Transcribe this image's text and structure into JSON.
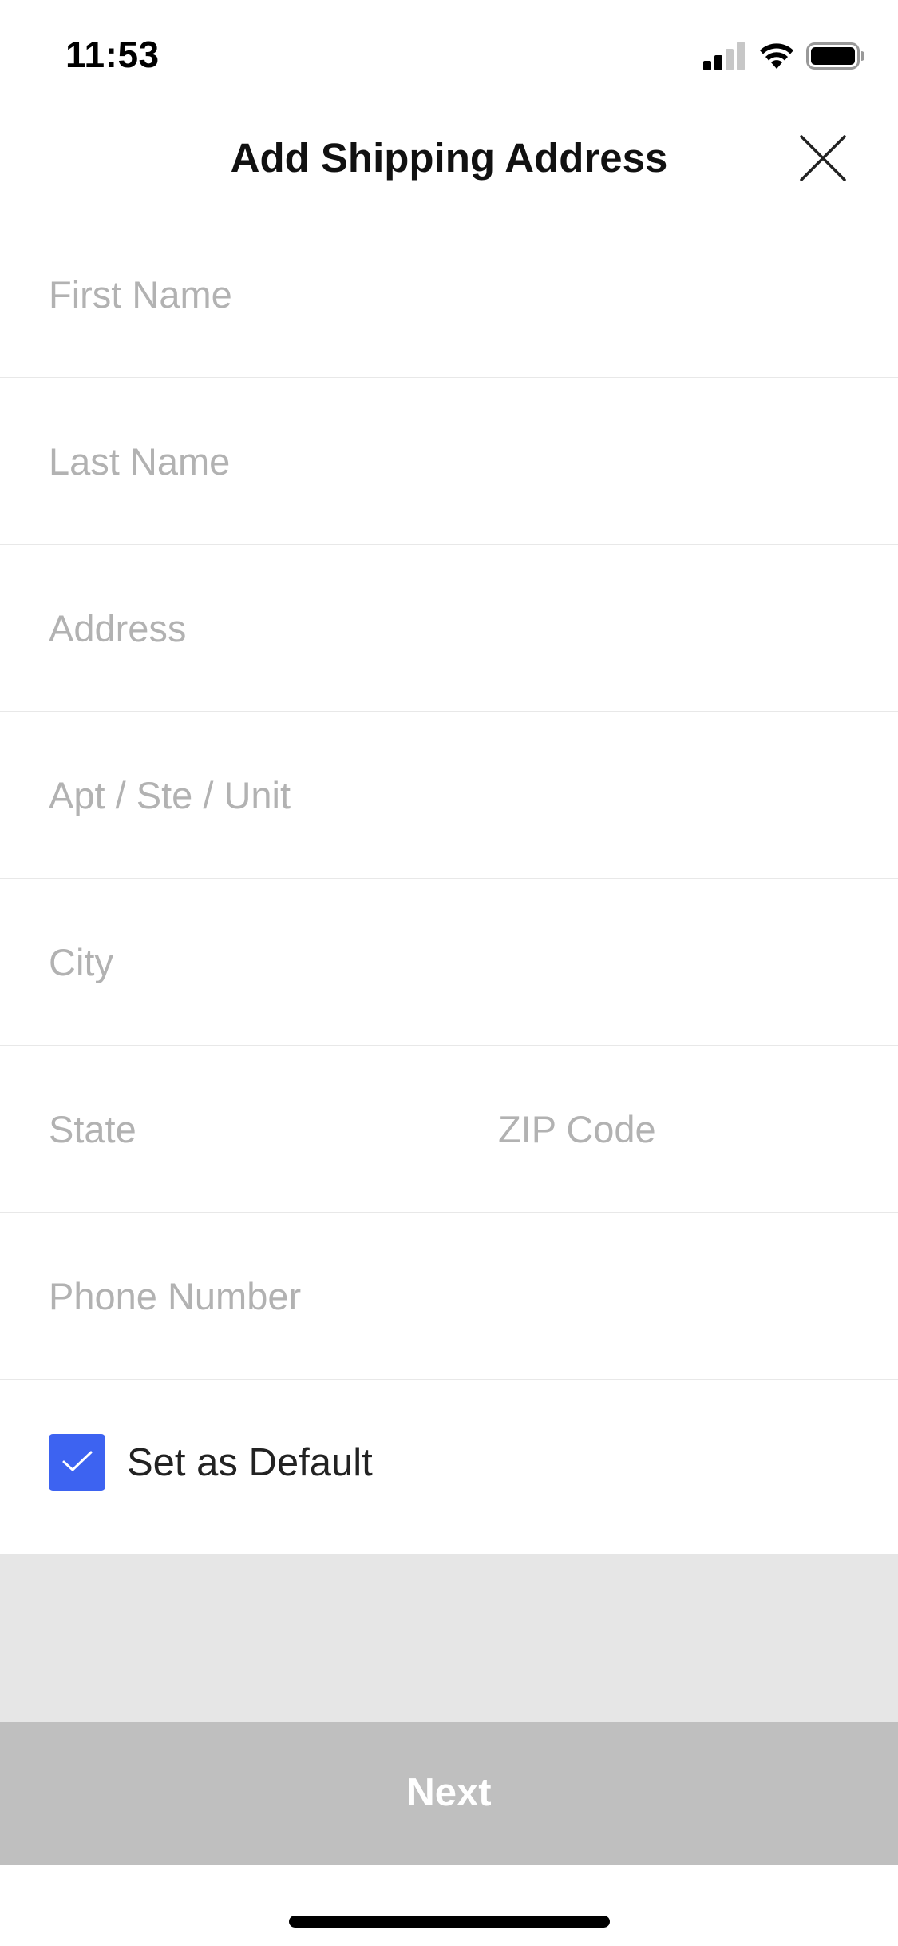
{
  "status_bar": {
    "time": "11:53"
  },
  "header": {
    "title": "Add Shipping Address"
  },
  "form": {
    "first_name_placeholder": "First Name",
    "last_name_placeholder": "Last Name",
    "address_placeholder": "Address",
    "apt_placeholder": "Apt / Ste / Unit",
    "city_placeholder": "City",
    "state_placeholder": "State",
    "zip_placeholder": "ZIP Code",
    "phone_placeholder": "Phone Number",
    "default_label": "Set as Default",
    "default_checked": true
  },
  "footer": {
    "next_label": "Next"
  },
  "colors": {
    "accent": "#3d63f1",
    "button_disabled": "#bfbfbf",
    "spacer_gray": "#e6e6e6",
    "placeholder": "#b2b2b2"
  },
  "icons": {
    "close": "close-icon",
    "checkmark": "checkmark-icon",
    "signal": "cellular-signal-icon",
    "wifi": "wifi-icon",
    "battery": "battery-icon"
  }
}
